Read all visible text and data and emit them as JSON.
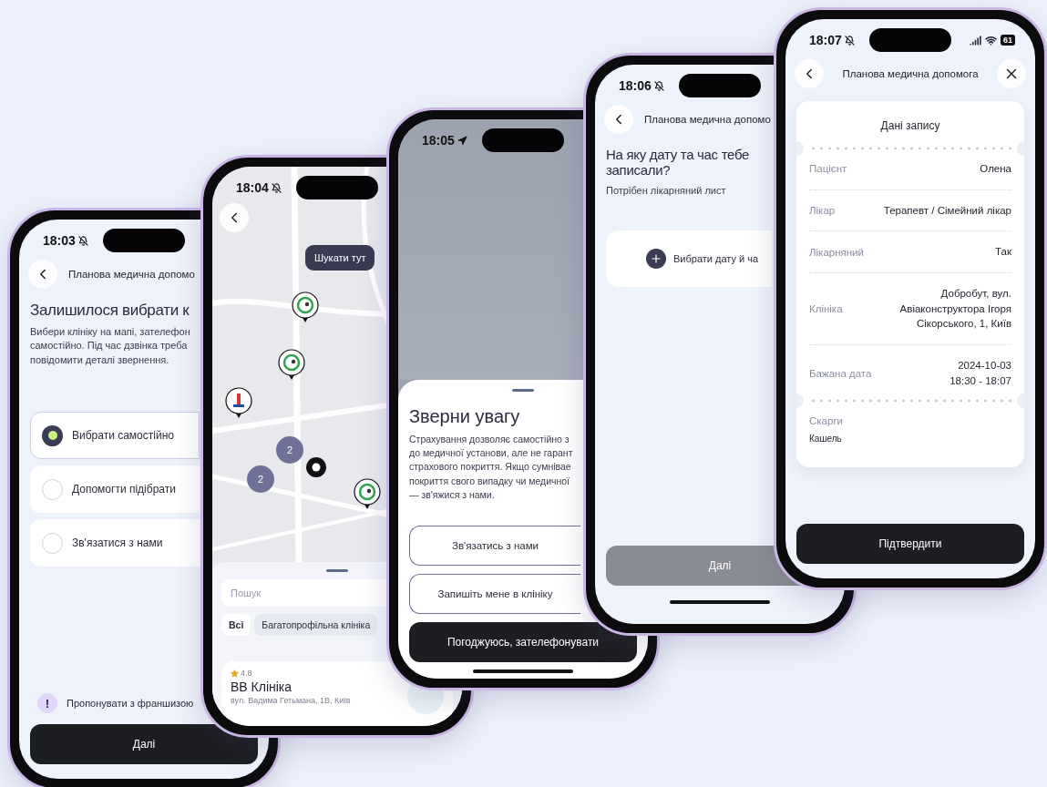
{
  "screens": [
    {
      "kind": "choice",
      "time": "18:03",
      "header": {
        "title": "Планова медична допомо"
      },
      "heading": "Залишилося вибрати к",
      "description": "Вибери клініку на мапі, зателефон\nсамостійно. Під час дзвінка треба\nповідомити деталі звернення.",
      "options": [
        {
          "label": "Вибрати самостійно",
          "selected": true
        },
        {
          "label": "Допомогти підібрати",
          "selected": false
        },
        {
          "label": "Зв'язатися з нами",
          "selected": false
        }
      ],
      "notice": {
        "icon": "!",
        "text": "Пропонувати з франшизою"
      },
      "button": {
        "label": "Далі",
        "disabled": false
      }
    },
    {
      "kind": "map",
      "time": "18:04",
      "search_here": "Шукати тут",
      "clusters": [
        "2",
        "2"
      ],
      "search": {
        "placeholder": "Пошук"
      },
      "filters": [
        {
          "label": "Всі",
          "selected": true
        },
        {
          "label": "Багатопрофільна клініка",
          "selected": false
        }
      ],
      "clinic": {
        "rating": "4.8",
        "name": "BB Клініка",
        "address": "вул. Вадима Гетьмана, 1В, Київ"
      }
    },
    {
      "kind": "sheet",
      "time": "18:05",
      "title": "Зверни увагу",
      "text": "Страхування дозволяє самостійно з\nдо медичної установи, але не гарант\nстрахового покриття. Якщо сумнівае\nпокриття свого випадку чи медичної\n— зв'яжися з нами.",
      "buttons": [
        {
          "label": "Зв'язатись з нами",
          "kind": "outline"
        },
        {
          "label": "Запишіть мене в клініку",
          "kind": "outline"
        },
        {
          "label": "Погоджуюсь, зателефонувати",
          "kind": "primary"
        }
      ]
    },
    {
      "kind": "date",
      "time": "18:06",
      "header": {
        "title": "Планова медична допомо"
      },
      "heading": "На яку дату та час тебе\nзаписали?",
      "subheading": "Потрібен лікарняний лист",
      "picker": "Вибрати дату й ча",
      "button": {
        "label": "Далі",
        "disabled": true
      }
    },
    {
      "kind": "summary",
      "time": "18:07",
      "battery": "61",
      "header": {
        "title": "Планова медична допомога"
      },
      "card_title": "Дані запису",
      "rows": [
        {
          "label": "Пацієнт",
          "value": "Олена"
        },
        {
          "label": "Лікар",
          "value": "Терапевт / Сімейний лікар"
        },
        {
          "label": "Лікарняний",
          "value": "Так"
        },
        {
          "label": "Клініка",
          "value": "Добробут, вул.\nАвіаконструктора Ігоря\nСікорського, 1, Київ"
        },
        {
          "label": "Бажана дата",
          "value": "2024-10-03\n18:30 - 18:07"
        }
      ],
      "complaints": {
        "label": "Скарги",
        "value": "Кашель"
      },
      "button": {
        "label": "Підтвердити",
        "disabled": false
      }
    }
  ]
}
